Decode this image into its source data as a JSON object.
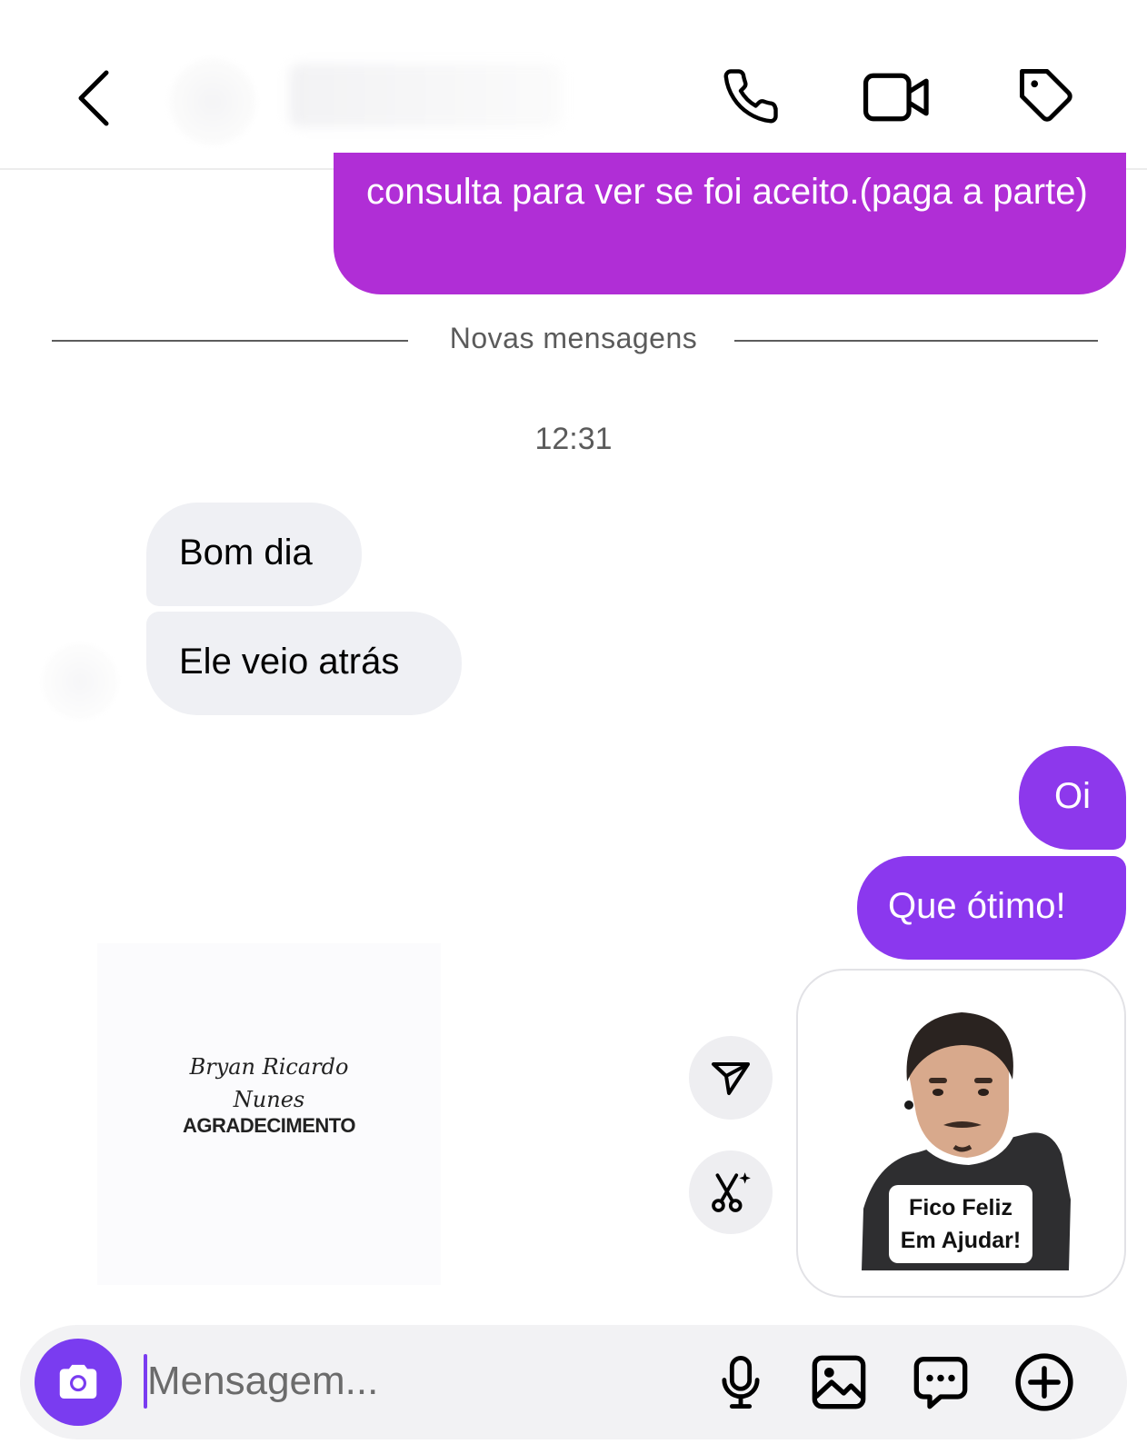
{
  "header": {
    "back_icon": "chevron-left-icon",
    "call_icon": "phone-icon",
    "video_icon": "video-camera-icon",
    "tag_icon": "tag-icon"
  },
  "messages": {
    "top_outgoing": "consulta para ver se foi aceito.(paga a parte)",
    "divider_label": "Novas mensagens",
    "timestamp": "12:31",
    "incoming_1": "Bom dia",
    "incoming_2": "Ele veio atrás",
    "outgoing_1": "Oi",
    "outgoing_2": "Que ótimo!"
  },
  "shared_card": {
    "signature_line1": "Bryan Ricardo",
    "signature_line2": "Nunes",
    "title": "AGRADECIMENTO"
  },
  "sticker": {
    "line1": "Fico Feliz",
    "line2": "Em Ajudar!"
  },
  "composer": {
    "placeholder": "Mensagem...",
    "camera_icon": "camera-icon",
    "mic_icon": "microphone-icon",
    "gallery_icon": "image-icon",
    "chat_icon": "chat-bubble-icon",
    "plus_icon": "plus-circle-icon"
  },
  "colors": {
    "outgoing_top": "#b02ed6",
    "outgoing_bottom": "#8b38ee",
    "incoming": "#eff0f4",
    "accent": "#7a3cf0"
  }
}
